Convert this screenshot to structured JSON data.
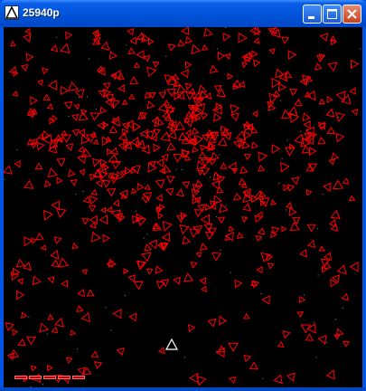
{
  "window": {
    "title": "25940p",
    "icons": {
      "app": "warning-triangle-icon",
      "minimize": "minimize-icon",
      "maximize": "maximize-icon",
      "close": "close-icon"
    }
  },
  "game": {
    "background_color": "#000000",
    "enemy_color": "#ff0000",
    "player_color": "#ffffff",
    "health_bar": {
      "segments": 5,
      "filled": 5,
      "color": "#ff0000"
    }
  }
}
